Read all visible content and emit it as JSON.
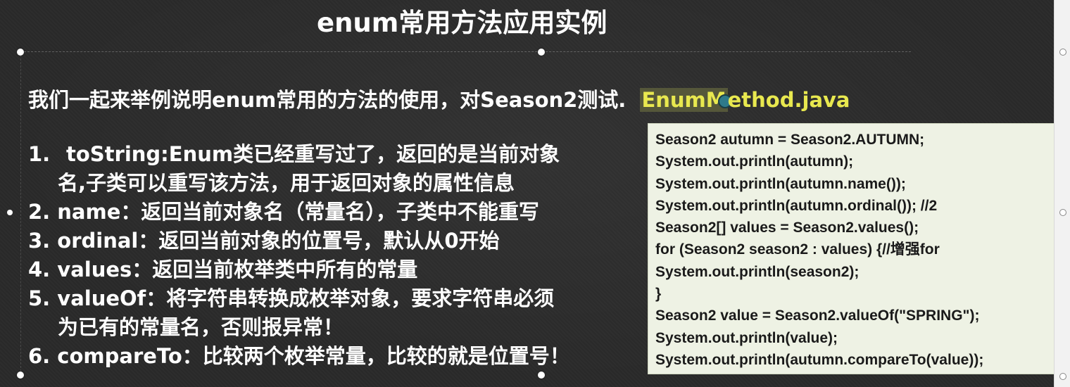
{
  "slide": {
    "title": "enum常用方法应用实例",
    "intro": "我们一起来举例说明enum常用的方法的使用，对Season2测试.",
    "filename_highlight": "EnumM",
    "filename_rest": "ethod.java",
    "items": [
      {
        "line1": "1.",
        "line1b": "toString:Enum类已经重写过了，返回的是当前对象",
        "line2": "名,子类可以重写该方法，用于返回对象的属性信息"
      },
      {
        "line1": "2. name：返回当前对象名（常量名），子类中不能重写"
      },
      {
        "line1": "3. ordinal：返回当前对象的位置号，默认从0开始"
      },
      {
        "line1": "4. values：返回当前枚举类中所有的常量"
      },
      {
        "line1": "5. valueOf：将字符串转换成枚举对象，要求字符串必须",
        "line2": "为已有的常量名，否则报异常！"
      },
      {
        "line1": "6. compareTo：比较两个枚举常量，比较的就是位置号！"
      }
    ],
    "code_lines": [
      "Season2 autumn = Season2.AUTUMN;",
      "System.out.println(autumn);",
      "System.out.println(autumn.name());",
      "System.out.println(autumn.ordinal()); //2",
      "Season2[] values = Season2.values();",
      "for (Season2 season2 : values) {//增强for",
      "System.out.println(season2);",
      "}",
      "Season2 value = Season2.valueOf(\"SPRING\");",
      "System.out.println(value);",
      "System.out.println(autumn.compareTo(value));"
    ]
  },
  "colors": {
    "background": "#2a2a2a",
    "text": "#ffffff",
    "filename": "#e8e84f",
    "code_bg": "#eef2e4",
    "code_text": "#1a1a1a"
  }
}
